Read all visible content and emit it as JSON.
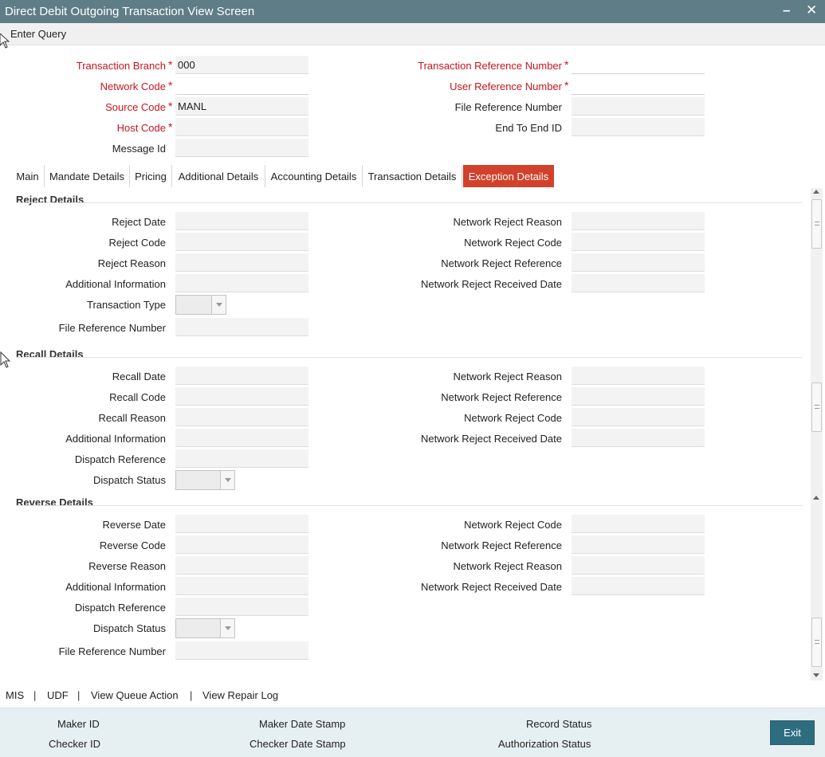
{
  "window": {
    "title": "Direct Debit Outgoing Transaction View Screen"
  },
  "menu": {
    "enter_query": "Enter Query"
  },
  "header": {
    "transaction_branch": {
      "label": "Transaction Branch",
      "value": "000"
    },
    "network_code": {
      "label": "Network Code",
      "value": ""
    },
    "source_code": {
      "label": "Source Code",
      "value": "MANL"
    },
    "host_code": {
      "label": "Host Code",
      "value": ""
    },
    "message_id": {
      "label": "Message Id",
      "value": ""
    },
    "transaction_reference_number": {
      "label": "Transaction Reference Number",
      "value": ""
    },
    "user_reference_number": {
      "label": "User Reference Number",
      "value": ""
    },
    "file_reference_number": {
      "label": "File Reference Number",
      "value": ""
    },
    "end_to_end_id": {
      "label": "End To End ID",
      "value": ""
    },
    "required_mark": "*"
  },
  "tabs": [
    "Main",
    "Mandate Details",
    "Pricing",
    "Additional Details",
    "Accounting Details",
    "Transaction Details",
    "Exception Details"
  ],
  "active_tab": "Exception Details",
  "reject": {
    "title": "Reject Details",
    "left": [
      "Reject Date",
      "Reject Code",
      "Reject Reason",
      "Additional Information",
      "Transaction Type",
      "File Reference Number"
    ],
    "right": [
      "Network Reject Reason",
      "Network Reject Code",
      "Network Reject Reference",
      "Network Reject Received Date"
    ]
  },
  "recall": {
    "title": "Recall Details",
    "left": [
      "Recall Date",
      "Recall Code",
      "Recall Reason",
      "Additional Information",
      "Dispatch Reference",
      "Dispatch Status"
    ],
    "right": [
      "Network Reject Reason",
      "Network Reject Reference",
      "Network Reject Code",
      "Network Reject Received Date"
    ]
  },
  "reverse": {
    "title": "Reverse Details",
    "left": [
      "Reverse Date",
      "Reverse Code",
      "Reverse Reason",
      "Additional Information",
      "Dispatch Reference",
      "Dispatch Status",
      "File Reference Number"
    ],
    "right": [
      "Network Reject Code",
      "Network Reject Reference",
      "Network Reject Reason",
      "Network Reject Received Date"
    ]
  },
  "links": [
    "MIS",
    "UDF",
    "View Queue Action",
    "View Repair Log"
  ],
  "link_separator": "|",
  "footer": {
    "maker_id": "Maker ID",
    "checker_id": "Checker ID",
    "maker_date_stamp": "Maker Date Stamp",
    "checker_date_stamp": "Checker Date Stamp",
    "record_status": "Record Status",
    "authorization_status": "Authorization Status",
    "exit": "Exit"
  },
  "colors": {
    "titlebar": "#5f7d86",
    "active_tab": "#d2412b",
    "required": "#c8141e",
    "exit_button": "#2e6d7f",
    "footer": "#e6eff1"
  }
}
